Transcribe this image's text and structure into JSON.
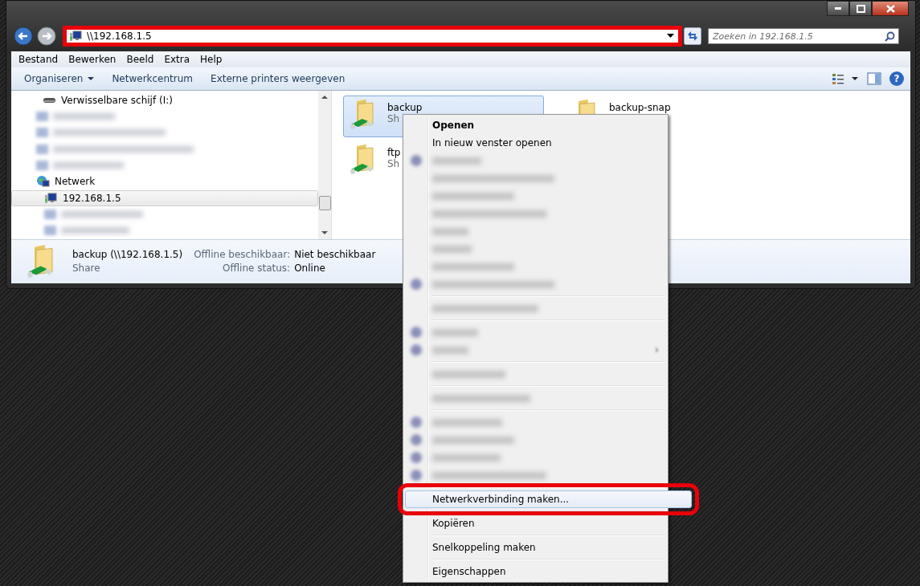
{
  "address_bar": {
    "value": "\\\\192.168.1.5",
    "highlighted": true
  },
  "search": {
    "placeholder": "Zoeken in 192.168.1.5"
  },
  "menu_bar": [
    "Bestand",
    "Bewerken",
    "Beeld",
    "Extra",
    "Help"
  ],
  "command_bar": [
    {
      "label": "Organiseren",
      "dropdown": true
    },
    {
      "label": "Netwerkcentrum",
      "dropdown": false
    },
    {
      "label": "Externe printers weergeven",
      "dropdown": false
    }
  ],
  "help_button": "?",
  "nav_tree": [
    {
      "kind": "drive",
      "label": "Verwisselbare schijf (I:)",
      "selected": false
    },
    {
      "kind": "blurred"
    },
    {
      "kind": "blurred"
    },
    {
      "kind": "blurred"
    },
    {
      "kind": "blurred"
    },
    {
      "kind": "network",
      "label": "Netwerk",
      "selected": false,
      "children": [
        {
          "kind": "computer",
          "label": "192.168.1.5",
          "selected": true
        },
        {
          "kind": "blurred"
        },
        {
          "kind": "blurred"
        }
      ]
    }
  ],
  "items": [
    {
      "name": "backup",
      "sub": "Sh",
      "selected": true
    },
    {
      "name": "backup-snap",
      "selected": false
    },
    {
      "name": "ftp",
      "sub": "Sh",
      "selected": false
    }
  ],
  "details": {
    "name": "backup (\\\\192.168.1.5)",
    "type": "Share",
    "fields": [
      {
        "label": "Offline beschikbaar:",
        "value": "Niet beschikbaar"
      },
      {
        "label": "Offline status:",
        "value": "Online"
      }
    ]
  },
  "context_menu": [
    {
      "kind": "item",
      "label": "Openen",
      "bold": true,
      "hover": false,
      "highlighted": false
    },
    {
      "kind": "item",
      "label": "In nieuw venster openen",
      "bold": false,
      "hover": false,
      "highlighted": false
    },
    {
      "kind": "blurred",
      "icon": true
    },
    {
      "kind": "blurred",
      "icon": false
    },
    {
      "kind": "blurred",
      "icon": false
    },
    {
      "kind": "blurred",
      "icon": false
    },
    {
      "kind": "blurred",
      "icon": false
    },
    {
      "kind": "blurred",
      "icon": false
    },
    {
      "kind": "blurred",
      "icon": false
    },
    {
      "kind": "blurred",
      "icon": true
    },
    {
      "kind": "separator"
    },
    {
      "kind": "blurred",
      "icon": false
    },
    {
      "kind": "separator"
    },
    {
      "kind": "blurred",
      "icon": true
    },
    {
      "kind": "blurred",
      "icon": true,
      "submenu": true
    },
    {
      "kind": "separator"
    },
    {
      "kind": "blurred",
      "icon": false
    },
    {
      "kind": "separator"
    },
    {
      "kind": "blurred",
      "icon": false
    },
    {
      "kind": "separator"
    },
    {
      "kind": "blurred",
      "icon": true
    },
    {
      "kind": "blurred",
      "icon": true
    },
    {
      "kind": "blurred",
      "icon": true
    },
    {
      "kind": "blurred",
      "icon": true
    },
    {
      "kind": "separator"
    },
    {
      "kind": "item",
      "label": "Netwerkverbinding maken...",
      "bold": false,
      "hover": true,
      "highlighted": true
    },
    {
      "kind": "separator"
    },
    {
      "kind": "item",
      "label": "Kopiëren",
      "bold": false,
      "hover": false,
      "highlighted": false
    },
    {
      "kind": "separator"
    },
    {
      "kind": "item",
      "label": "Snelkoppeling maken",
      "bold": false,
      "hover": false,
      "highlighted": false
    },
    {
      "kind": "separator"
    },
    {
      "kind": "item",
      "label": "Eigenschappen",
      "bold": false,
      "hover": false,
      "highlighted": false
    }
  ]
}
